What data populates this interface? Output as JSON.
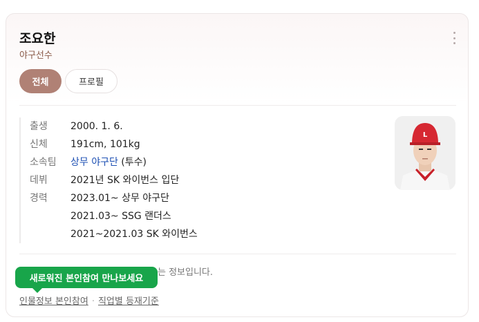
{
  "profile": {
    "name": "조요한",
    "role": "야구선수"
  },
  "tabs": [
    {
      "label": "전체",
      "active": true
    },
    {
      "label": "프로필",
      "active": false
    }
  ],
  "info": {
    "birth": {
      "label": "출생",
      "value": "2000. 1. 6."
    },
    "body": {
      "label": "신체",
      "value": "191cm, 101kg"
    },
    "team": {
      "label": "소속팀",
      "link": "상무 야구단",
      "suffix": " (투수)"
    },
    "debut": {
      "label": "데뷔",
      "value": "2021년 SK 와이번스 입단"
    },
    "career": {
      "label": "경력",
      "items": [
        "2023.01~ 상무 야구단",
        "2021.03~ SSG 랜더스",
        "2021~2021.03 SK 와이번스"
      ]
    }
  },
  "notice": {
    "text_suffix": "는 정보입니다."
  },
  "tooltip": {
    "text": "새로워진 본인참여 만나보세요"
  },
  "footer": {
    "link1": "인물정보 본인참여",
    "separator": "·",
    "link2": "직업별 등재기준"
  },
  "colors": {
    "accent": "#b08175",
    "link": "#1c4fb3",
    "tooltip": "#18a54a"
  }
}
